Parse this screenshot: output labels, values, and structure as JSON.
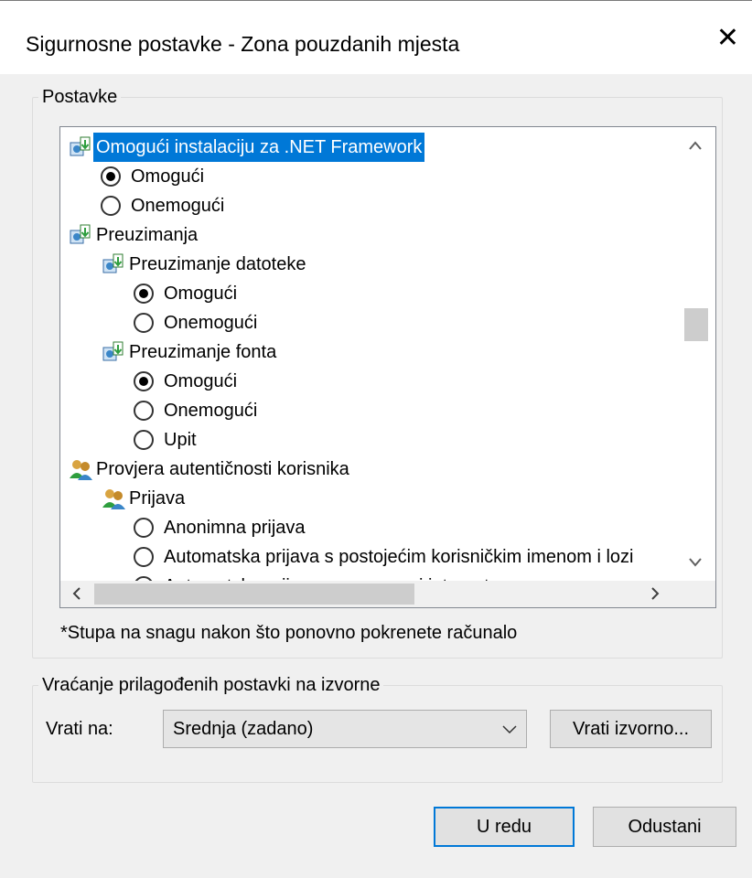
{
  "window": {
    "title": "Sigurnosne postavke - Zona pouzdanih mjesta",
    "close_glyph": "✕"
  },
  "settings_group": {
    "legend": "Postavke",
    "tree": [
      {
        "label": "Omogući instalaciju za .NET Framework",
        "type": "category",
        "icon": "download-settings-icon",
        "selected": true
      },
      {
        "label": "Omogući",
        "type": "radio",
        "checked": true
      },
      {
        "label": "Onemogući",
        "type": "radio",
        "checked": false
      },
      {
        "label": "Preuzimanja",
        "type": "category",
        "icon": "download-settings-icon"
      },
      {
        "label": "Preuzimanje datoteke",
        "type": "category",
        "icon": "download-settings-icon"
      },
      {
        "label": "Omogući",
        "type": "radio",
        "checked": true
      },
      {
        "label": "Onemogući",
        "type": "radio",
        "checked": false
      },
      {
        "label": "Preuzimanje fonta",
        "type": "category",
        "icon": "download-settings-icon"
      },
      {
        "label": "Omogući",
        "type": "radio",
        "checked": true
      },
      {
        "label": "Onemogući",
        "type": "radio",
        "checked": false
      },
      {
        "label": "Upit",
        "type": "radio",
        "checked": false
      },
      {
        "label": "Provjera autentičnosti korisnika",
        "type": "category",
        "icon": "users-icon"
      },
      {
        "label": "Prijava",
        "type": "category",
        "icon": "users-icon"
      },
      {
        "label": "Anonimna prijava",
        "type": "radio",
        "checked": false
      },
      {
        "label": "Automatska prijava s postojećim korisničkim imenom i lozi",
        "type": "radio",
        "checked": false
      },
      {
        "label": "Automatska prijava samo u zoni intraneta",
        "type": "radio",
        "checked": true
      }
    ],
    "scroll": {
      "up_arrow": "^",
      "down_arrow": "v",
      "left_arrow": "<",
      "right_arrow": ">"
    },
    "note": "*Stupa na snagu nakon što ponovno pokrenete računalo"
  },
  "reset_group": {
    "legend": "Vraćanje prilagođenih postavki na izvorne",
    "reset_to_label": "Vrati na:",
    "level_value": "Srednja (zadano)",
    "reset_button": "Vrati izvorno..."
  },
  "footer": {
    "ok_button": "U redu",
    "cancel_button": "Odustani"
  },
  "colors": {
    "selection": "#0078d7",
    "focus_border": "#0078d7"
  }
}
